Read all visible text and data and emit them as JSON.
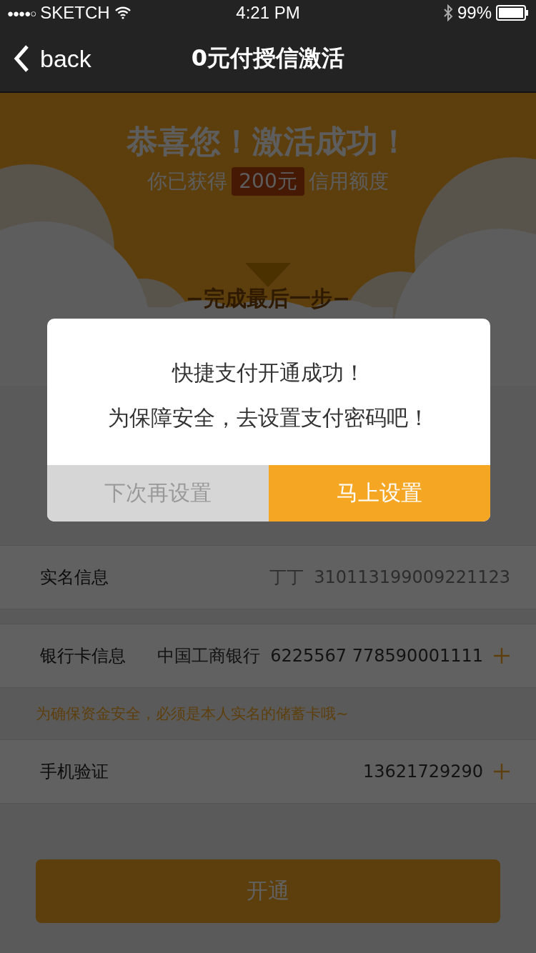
{
  "status_bar": {
    "signal": "●●●●○",
    "carrier": "SKETCH",
    "time": "4:21 PM",
    "battery": "99%"
  },
  "nav": {
    "back_label": "back",
    "title": "0元付授信激活"
  },
  "banner": {
    "headline": "恭喜您！激活成功！",
    "credit_prefix": "你已获得",
    "credit_amount": "200元",
    "credit_suffix": "信用额度",
    "step_label": "−完成最后一步−"
  },
  "sections": [
    {
      "rows": [
        {
          "kind": "field",
          "label": "实名信息",
          "values": [
            "丁丁",
            "310113199009221123"
          ],
          "muted": true,
          "addable": false
        }
      ]
    },
    {
      "rows": [
        {
          "kind": "field",
          "label": "银行卡信息",
          "values": [
            "中国工商银行",
            "6225567 778590001111"
          ],
          "muted": false,
          "addable": true
        },
        {
          "kind": "note",
          "text": "为确保资金安全，必须是本人实名的储蓄卡哦~"
        },
        {
          "kind": "field",
          "label": "手机验证",
          "values": [
            "13621729290"
          ],
          "muted": false,
          "addable": true
        }
      ]
    }
  ],
  "submit_button": "开通",
  "dialog": {
    "lines": [
      "快捷支付开通成功！",
      "为保障安全，去设置支付密码吧！"
    ],
    "buttons": [
      {
        "label": "下次再设置",
        "kind": "secondary"
      },
      {
        "label": "马上设置",
        "kind": "primary"
      }
    ]
  }
}
